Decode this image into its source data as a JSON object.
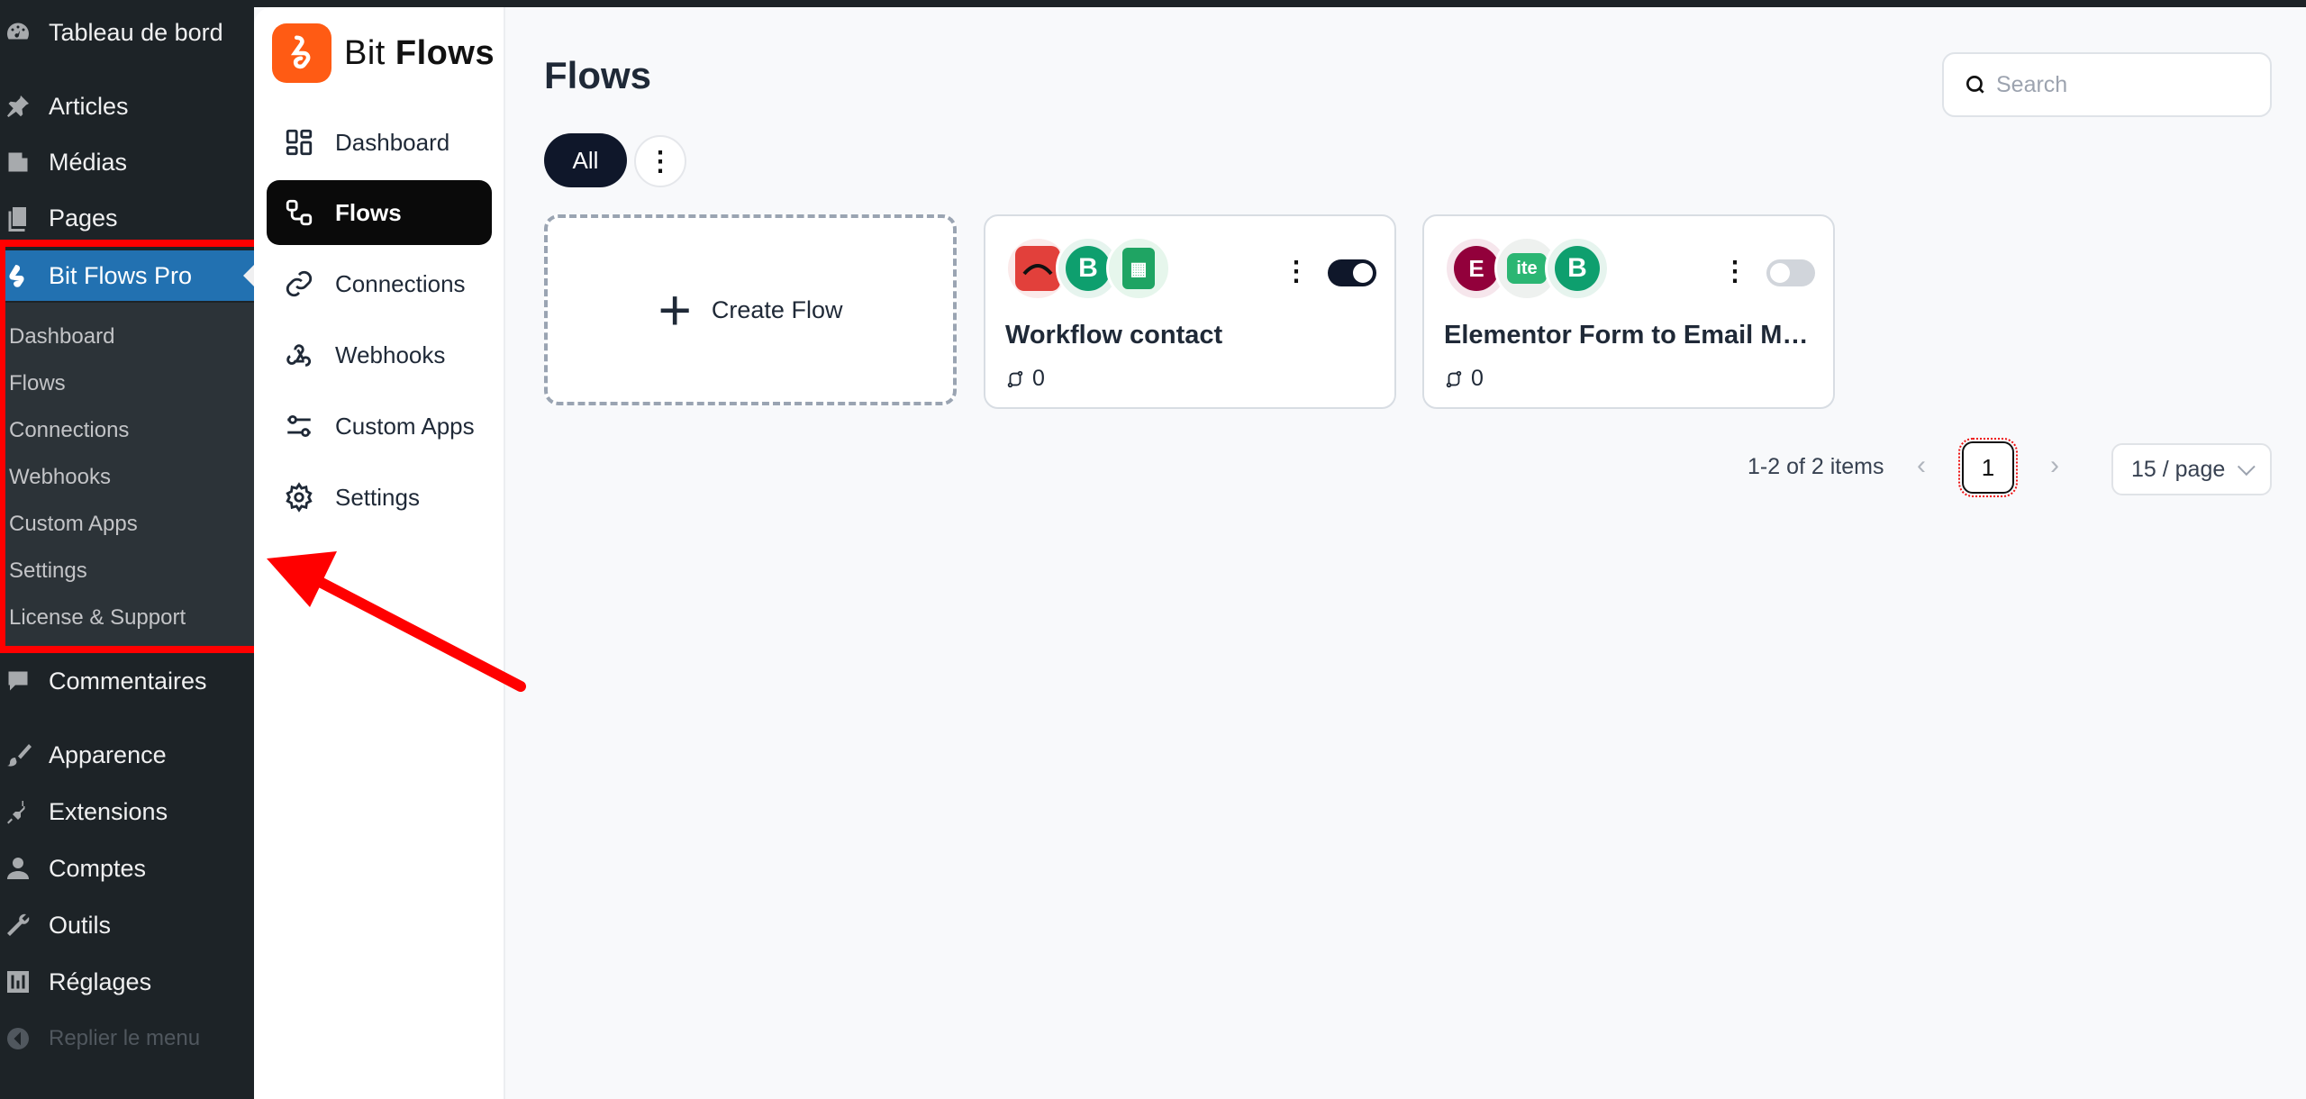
{
  "wp_menu": {
    "top_item": "Tableau de bord",
    "items": [
      {
        "label": "Articles",
        "icon": "pin-icon"
      },
      {
        "label": "Médias",
        "icon": "media-icon"
      },
      {
        "label": "Pages",
        "icon": "pages-icon"
      },
      {
        "label": "Bit Flows Pro",
        "icon": "bitflows-icon",
        "active": true
      },
      {
        "label": "Commentaires",
        "icon": "comments-icon"
      },
      {
        "label": "Apparence",
        "icon": "brush-icon"
      },
      {
        "label": "Extensions",
        "icon": "plugin-icon"
      },
      {
        "label": "Comptes",
        "icon": "user-icon"
      },
      {
        "label": "Outils",
        "icon": "wrench-icon"
      },
      {
        "label": "Réglages",
        "icon": "sliders-icon"
      }
    ],
    "collapse": "Replier le menu",
    "submenu": [
      "Dashboard",
      "Flows",
      "Connections",
      "Webhooks",
      "Custom Apps",
      "Settings",
      "License & Support"
    ]
  },
  "plugin": {
    "logo_text_light": "Bit ",
    "logo_text_bold": "Flows",
    "nav": [
      {
        "label": "Dashboard",
        "icon": "dashboard-icon"
      },
      {
        "label": "Flows",
        "icon": "flows-icon",
        "active": true
      },
      {
        "label": "Connections",
        "icon": "link-icon"
      },
      {
        "label": "Webhooks",
        "icon": "webhook-icon"
      },
      {
        "label": "Custom Apps",
        "icon": "custom-apps-icon"
      },
      {
        "label": "Settings",
        "icon": "gear-icon"
      }
    ]
  },
  "main": {
    "title": "Flows",
    "search_placeholder": "Search",
    "filter_all": "All",
    "create_label": "Create Flow",
    "flows": [
      {
        "title": "Workflow contact",
        "runs": "0",
        "enabled": true,
        "apps": [
          "cf7-icon",
          "bit-icon",
          "google-sheets-icon"
        ]
      },
      {
        "title": "Elementor Form to Email Mar...",
        "runs": "0",
        "enabled": false,
        "apps": [
          "elementor-icon",
          "brevo-icon",
          "bit-icon"
        ]
      }
    ],
    "pagination": {
      "summary": "1-2 of 2 items",
      "current_page": "1",
      "page_size": "15 / page"
    }
  },
  "colors": {
    "wp_sidebar": "#1d2327",
    "wp_active": "#2271b1",
    "brand_orange": "#ff5b14",
    "highlight_red": "#ff0000"
  }
}
